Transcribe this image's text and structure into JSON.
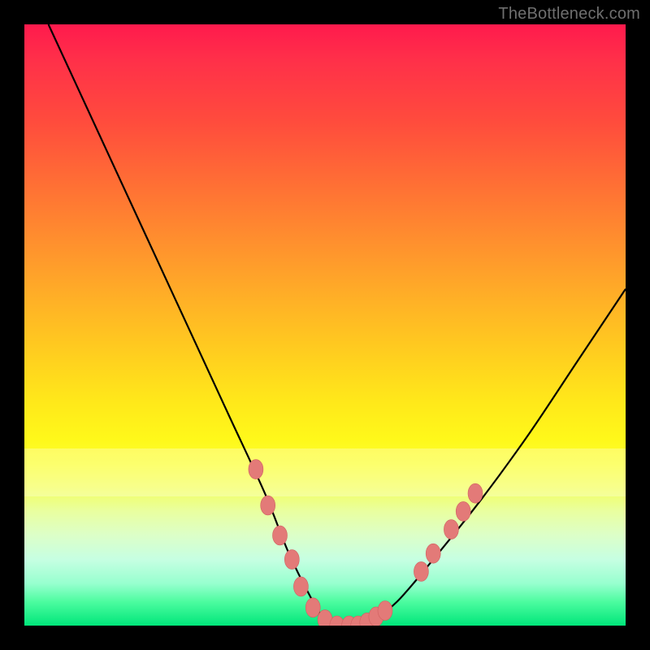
{
  "attribution": "TheBottleneck.com",
  "colors": {
    "frame": "#000000",
    "curve": "#000000",
    "markers_fill": "#e37a78",
    "markers_stroke": "#d16060",
    "gradient_top": "#ff1a4d",
    "gradient_bottom": "#00e67a"
  },
  "chart_data": {
    "type": "line",
    "title": "",
    "xlabel": "",
    "ylabel": "",
    "xlim": [
      0,
      100
    ],
    "ylim": [
      0,
      100
    ],
    "grid": false,
    "legend": false,
    "series": [
      {
        "name": "curve",
        "x": [
          4,
          10,
          16,
          22,
          28,
          34,
          40,
          44,
          48,
          50,
          52,
          54,
          56,
          58,
          62,
          68,
          76,
          84,
          92,
          100
        ],
        "values": [
          100,
          87,
          74,
          61,
          48,
          35,
          22,
          12,
          4,
          1,
          0,
          0,
          0,
          1,
          4,
          11,
          21,
          32,
          44,
          56
        ]
      }
    ],
    "markers": [
      {
        "x": 38.5,
        "y": 26
      },
      {
        "x": 40.5,
        "y": 20
      },
      {
        "x": 42.5,
        "y": 15
      },
      {
        "x": 44.5,
        "y": 11
      },
      {
        "x": 46.0,
        "y": 6.5
      },
      {
        "x": 48.0,
        "y": 3
      },
      {
        "x": 50.0,
        "y": 1
      },
      {
        "x": 52.0,
        "y": 0
      },
      {
        "x": 54.0,
        "y": 0
      },
      {
        "x": 55.5,
        "y": 0
      },
      {
        "x": 57.0,
        "y": 0.5
      },
      {
        "x": 58.5,
        "y": 1.5
      },
      {
        "x": 60.0,
        "y": 2.5
      },
      {
        "x": 66.0,
        "y": 9
      },
      {
        "x": 68.0,
        "y": 12
      },
      {
        "x": 71.0,
        "y": 16
      },
      {
        "x": 73.0,
        "y": 19
      },
      {
        "x": 75.0,
        "y": 22
      }
    ]
  }
}
